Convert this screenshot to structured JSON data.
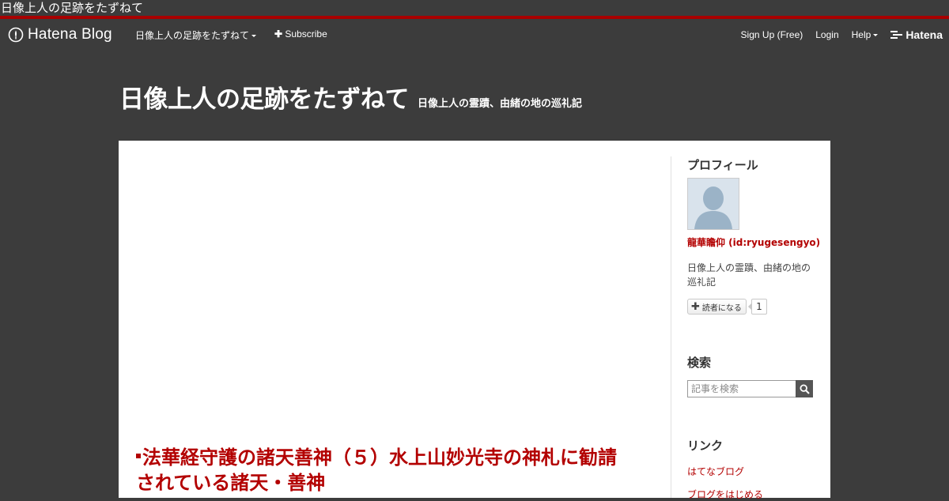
{
  "window": {
    "title": "日像上人の足跡をたずねて"
  },
  "navbar": {
    "logo_text": "Hatena Blog",
    "blog_menu_label": "日像上人の足跡をたずねて",
    "subscribe_label": "Subscribe",
    "signup_label": "Sign Up (Free)",
    "login_label": "Login",
    "help_label": "Help",
    "hatena_label": "Hatena"
  },
  "header": {
    "title": "日像上人の足跡をたずねて",
    "description": "日像上人の霊蹟、由緒の地の巡礼記"
  },
  "entry": {
    "title": "法華経守護の諸天善神（５）水上山妙光寺の神札に勧請されている諸天・善神"
  },
  "sidebar": {
    "profile": {
      "heading": "プロフィール",
      "name": "龍華瞻仰 (id:ryugesengyo)",
      "description": "日像上人の霊蹟、由緒の地の巡礼記",
      "reader_button_label": "読者になる",
      "reader_count": "1"
    },
    "search": {
      "heading": "検索",
      "placeholder": "記事を検索"
    },
    "links": {
      "heading": "リンク",
      "items": [
        "はてなブログ",
        "ブログをはじめる"
      ]
    }
  },
  "colors": {
    "accent": "#b30000",
    "rule": "#a80000",
    "background": "#3c3c3c",
    "card": "#ffffff"
  }
}
